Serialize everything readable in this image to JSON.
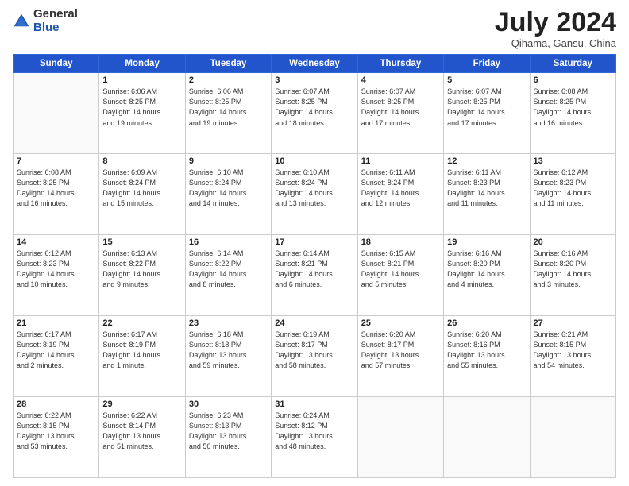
{
  "header": {
    "logo_line1": "General",
    "logo_line2": "Blue",
    "month_title": "July 2024",
    "location": "Qihama, Gansu, China"
  },
  "weekdays": [
    "Sunday",
    "Monday",
    "Tuesday",
    "Wednesday",
    "Thursday",
    "Friday",
    "Saturday"
  ],
  "weeks": [
    [
      {
        "num": "",
        "info": ""
      },
      {
        "num": "1",
        "info": "Sunrise: 6:06 AM\nSunset: 8:25 PM\nDaylight: 14 hours\nand 19 minutes."
      },
      {
        "num": "2",
        "info": "Sunrise: 6:06 AM\nSunset: 8:25 PM\nDaylight: 14 hours\nand 19 minutes."
      },
      {
        "num": "3",
        "info": "Sunrise: 6:07 AM\nSunset: 8:25 PM\nDaylight: 14 hours\nand 18 minutes."
      },
      {
        "num": "4",
        "info": "Sunrise: 6:07 AM\nSunset: 8:25 PM\nDaylight: 14 hours\nand 17 minutes."
      },
      {
        "num": "5",
        "info": "Sunrise: 6:07 AM\nSunset: 8:25 PM\nDaylight: 14 hours\nand 17 minutes."
      },
      {
        "num": "6",
        "info": "Sunrise: 6:08 AM\nSunset: 8:25 PM\nDaylight: 14 hours\nand 16 minutes."
      }
    ],
    [
      {
        "num": "7",
        "info": "Sunrise: 6:08 AM\nSunset: 8:25 PM\nDaylight: 14 hours\nand 16 minutes."
      },
      {
        "num": "8",
        "info": "Sunrise: 6:09 AM\nSunset: 8:24 PM\nDaylight: 14 hours\nand 15 minutes."
      },
      {
        "num": "9",
        "info": "Sunrise: 6:10 AM\nSunset: 8:24 PM\nDaylight: 14 hours\nand 14 minutes."
      },
      {
        "num": "10",
        "info": "Sunrise: 6:10 AM\nSunset: 8:24 PM\nDaylight: 14 hours\nand 13 minutes."
      },
      {
        "num": "11",
        "info": "Sunrise: 6:11 AM\nSunset: 8:24 PM\nDaylight: 14 hours\nand 12 minutes."
      },
      {
        "num": "12",
        "info": "Sunrise: 6:11 AM\nSunset: 8:23 PM\nDaylight: 14 hours\nand 11 minutes."
      },
      {
        "num": "13",
        "info": "Sunrise: 6:12 AM\nSunset: 8:23 PM\nDaylight: 14 hours\nand 11 minutes."
      }
    ],
    [
      {
        "num": "14",
        "info": "Sunrise: 6:12 AM\nSunset: 8:23 PM\nDaylight: 14 hours\nand 10 minutes."
      },
      {
        "num": "15",
        "info": "Sunrise: 6:13 AM\nSunset: 8:22 PM\nDaylight: 14 hours\nand 9 minutes."
      },
      {
        "num": "16",
        "info": "Sunrise: 6:14 AM\nSunset: 8:22 PM\nDaylight: 14 hours\nand 8 minutes."
      },
      {
        "num": "17",
        "info": "Sunrise: 6:14 AM\nSunset: 8:21 PM\nDaylight: 14 hours\nand 6 minutes."
      },
      {
        "num": "18",
        "info": "Sunrise: 6:15 AM\nSunset: 8:21 PM\nDaylight: 14 hours\nand 5 minutes."
      },
      {
        "num": "19",
        "info": "Sunrise: 6:16 AM\nSunset: 8:20 PM\nDaylight: 14 hours\nand 4 minutes."
      },
      {
        "num": "20",
        "info": "Sunrise: 6:16 AM\nSunset: 8:20 PM\nDaylight: 14 hours\nand 3 minutes."
      }
    ],
    [
      {
        "num": "21",
        "info": "Sunrise: 6:17 AM\nSunset: 8:19 PM\nDaylight: 14 hours\nand 2 minutes."
      },
      {
        "num": "22",
        "info": "Sunrise: 6:17 AM\nSunset: 8:19 PM\nDaylight: 14 hours\nand 1 minute."
      },
      {
        "num": "23",
        "info": "Sunrise: 6:18 AM\nSunset: 8:18 PM\nDaylight: 13 hours\nand 59 minutes."
      },
      {
        "num": "24",
        "info": "Sunrise: 6:19 AM\nSunset: 8:17 PM\nDaylight: 13 hours\nand 58 minutes."
      },
      {
        "num": "25",
        "info": "Sunrise: 6:20 AM\nSunset: 8:17 PM\nDaylight: 13 hours\nand 57 minutes."
      },
      {
        "num": "26",
        "info": "Sunrise: 6:20 AM\nSunset: 8:16 PM\nDaylight: 13 hours\nand 55 minutes."
      },
      {
        "num": "27",
        "info": "Sunrise: 6:21 AM\nSunset: 8:15 PM\nDaylight: 13 hours\nand 54 minutes."
      }
    ],
    [
      {
        "num": "28",
        "info": "Sunrise: 6:22 AM\nSunset: 8:15 PM\nDaylight: 13 hours\nand 53 minutes."
      },
      {
        "num": "29",
        "info": "Sunrise: 6:22 AM\nSunset: 8:14 PM\nDaylight: 13 hours\nand 51 minutes."
      },
      {
        "num": "30",
        "info": "Sunrise: 6:23 AM\nSunset: 8:13 PM\nDaylight: 13 hours\nand 50 minutes."
      },
      {
        "num": "31",
        "info": "Sunrise: 6:24 AM\nSunset: 8:12 PM\nDaylight: 13 hours\nand 48 minutes."
      },
      {
        "num": "",
        "info": ""
      },
      {
        "num": "",
        "info": ""
      },
      {
        "num": "",
        "info": ""
      }
    ]
  ]
}
